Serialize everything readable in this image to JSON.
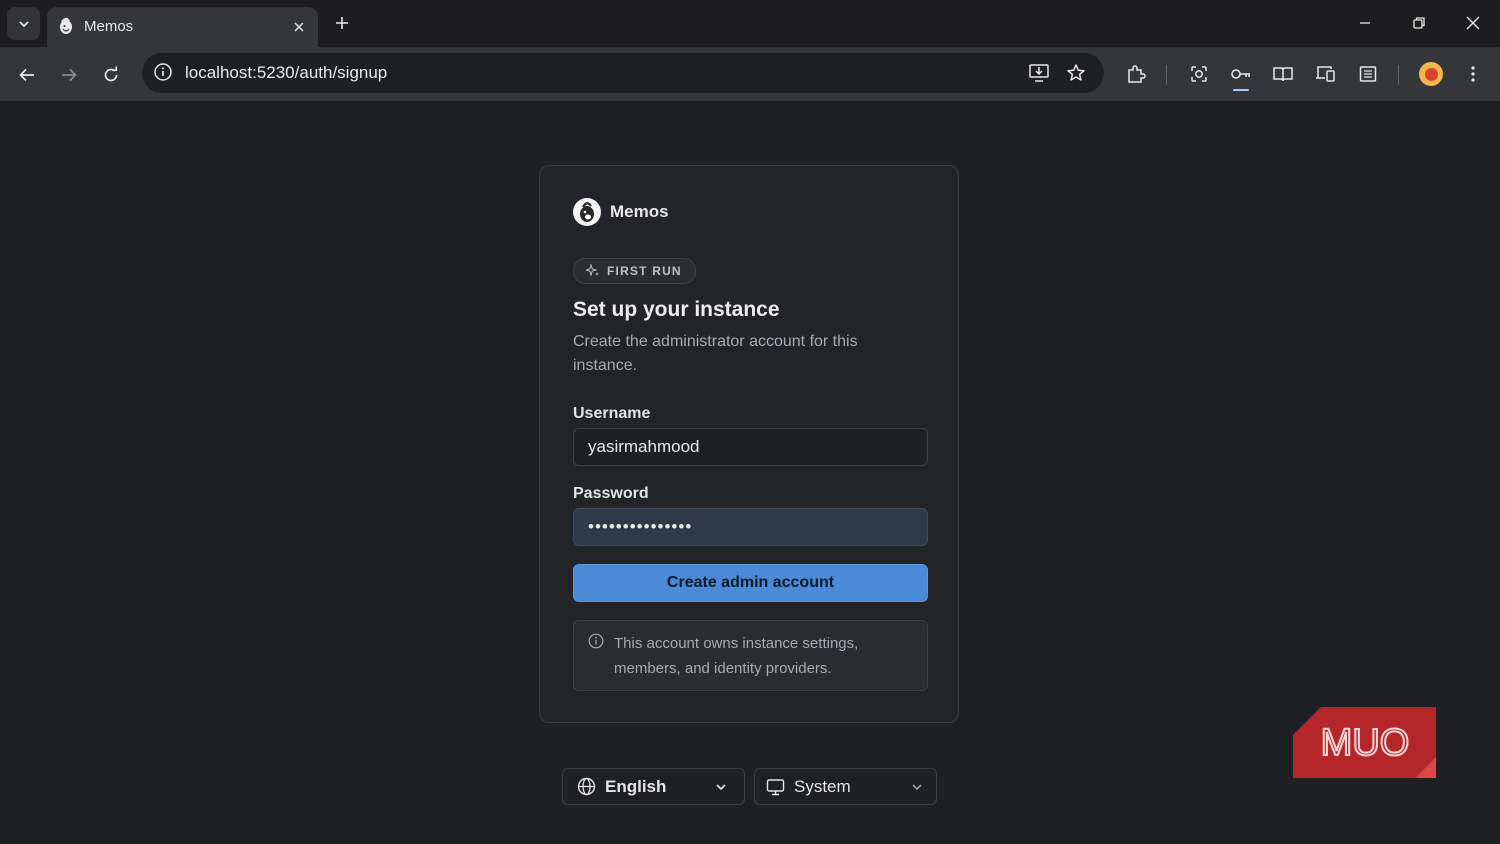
{
  "browser": {
    "tab": {
      "title": "Memos",
      "favicon": "memos-logo-icon"
    },
    "url": "localhost:5230/auth/signup",
    "icons": [
      "tab-list-icon",
      "new-tab-icon",
      "minimize-icon",
      "restore-icon",
      "close-icon",
      "back-icon",
      "forward-icon",
      "reload-icon",
      "site-info-icon",
      "install-app-icon",
      "bookmark-star-icon",
      "extensions-icon",
      "lens-icon",
      "password-key-icon",
      "reading-mode-icon",
      "devices-icon",
      "reading-list-icon",
      "profile-avatar",
      "more-menu-icon"
    ]
  },
  "card": {
    "brand": "Memos",
    "badge": "FIRST RUN",
    "title": "Set up your instance",
    "subtitle": "Create the administrator account for this instance.",
    "username_label": "Username",
    "username_value": "yasirmahmood",
    "password_label": "Password",
    "password_value": "•••••••••••••••",
    "submit_label": "Create admin account",
    "note": "This account owns instance settings, members, and identity providers."
  },
  "footer": {
    "language": "English",
    "theme": "System"
  },
  "watermark": "MUO",
  "colors": {
    "accent": "#4a8ad6",
    "page_bg": "#1f2023",
    "card_bg": "#232428",
    "watermark": "#c0282d"
  }
}
